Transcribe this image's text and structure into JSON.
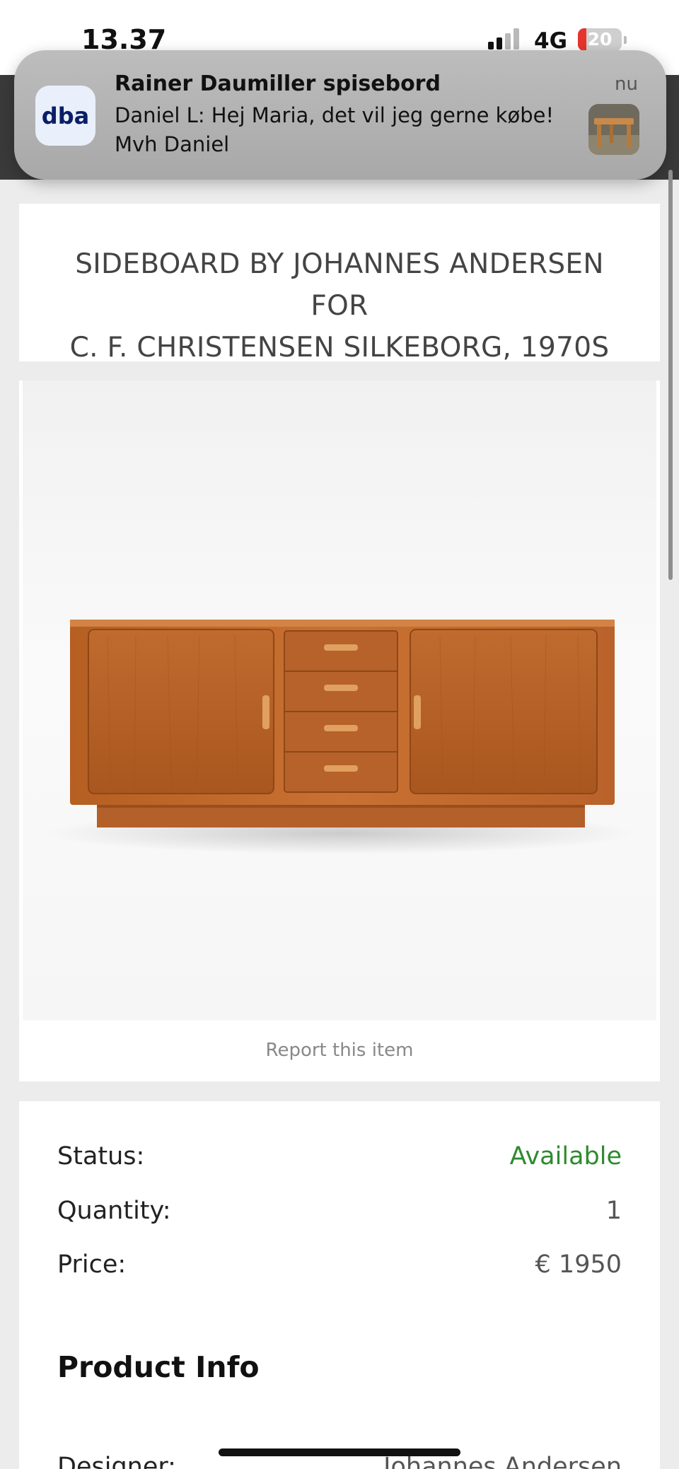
{
  "status_bar": {
    "time": "13.37",
    "network": "4G",
    "battery": "20",
    "battery_level_percent": 20
  },
  "notification": {
    "app_icon_text": "dba",
    "title": "Rainer Daumiller spisebord",
    "body_line1": "Daniel L: Hej Maria, det vil jeg gerne købe!",
    "body_line2": "Mvh Daniel",
    "time": "nu",
    "thumbnail": "table-photo"
  },
  "product": {
    "title_line1": "SIDEBOARD BY JOHANNES ANDERSEN FOR",
    "title_line2": "C. F. CHRISTENSEN SILKEBORG, 1970S",
    "image": "teak-sideboard-photo",
    "report_link": "Report this item"
  },
  "details": {
    "status_label": "Status:",
    "status_value": "Available",
    "quantity_label": "Quantity:",
    "quantity_value": "1",
    "price_label": "Price:",
    "price_value": "€ 1950",
    "section_title": "Product Info",
    "designer_label": "Designer:",
    "designer_value": "Johannes Andersen"
  },
  "colors": {
    "available": "#2e8b2e",
    "page_background": "#ececec",
    "wood": "#c0692a"
  }
}
